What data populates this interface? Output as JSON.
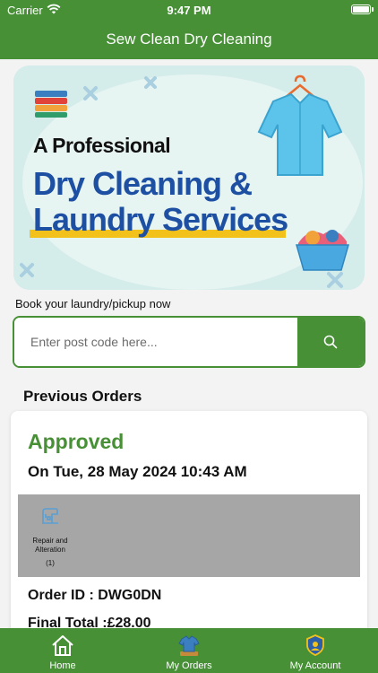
{
  "status_bar": {
    "carrier": "Carrier",
    "time": "9:47 PM"
  },
  "header": {
    "title": "Sew Clean Dry Cleaning"
  },
  "banner": {
    "line1": "A Professional",
    "line2": "Dry Cleaning &",
    "line3": "Laundry Services"
  },
  "booking": {
    "label": "Book your laundry/pickup now"
  },
  "search": {
    "placeholder": "Enter post code here...",
    "value": ""
  },
  "orders": {
    "title": "Previous Orders",
    "list": [
      {
        "status": "Approved",
        "date": "On Tue, 28 May 2024 10:43 AM",
        "items": [
          {
            "name": "Repair and Alteration",
            "qty": "(1)",
            "icon": "sewing-machine-icon"
          }
        ],
        "order_id": "Order ID : DWG0DN",
        "total": "Final Total :£28.00"
      }
    ]
  },
  "tabs": [
    {
      "label": "Home",
      "icon": "home-icon"
    },
    {
      "label": "My Orders",
      "icon": "shirt-icon"
    },
    {
      "label": "My Account",
      "icon": "shield-icon"
    }
  ],
  "colors": {
    "brand_green": "#479036",
    "banner_blue": "#1d4fa3",
    "banner_bg": "#d4ecea",
    "item_strip": "#a6a6a6"
  }
}
